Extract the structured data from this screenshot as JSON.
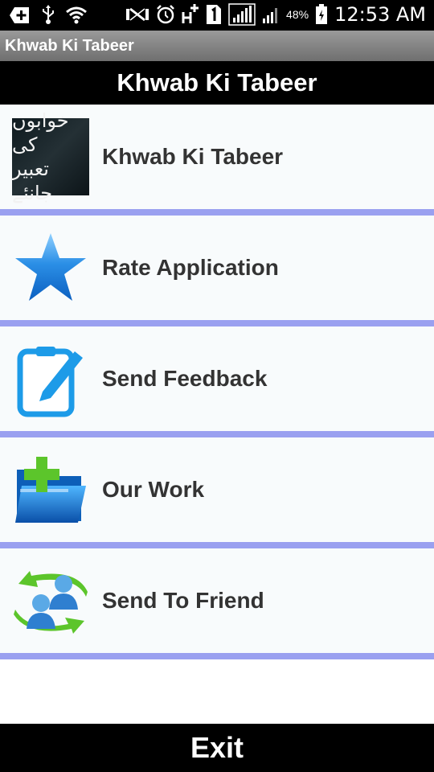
{
  "status_bar": {
    "battery": "48%",
    "time": "12:53 AM",
    "icons": [
      "add-icon",
      "usb-icon",
      "wifi-icon",
      "nfc-icon",
      "alarm-icon",
      "hplus-icon",
      "sim-1-icon",
      "signal-icon",
      "signal-2-icon",
      "battery-icon"
    ]
  },
  "app_title": "Khwab Ki Tabeer",
  "header": {
    "title": "Khwab Ki Tabeer"
  },
  "menu": {
    "items": [
      {
        "label": "Khwab Ki Tabeer",
        "icon": "app-thumbnail"
      },
      {
        "label": "Rate Application",
        "icon": "star-icon"
      },
      {
        "label": "Send Feedback",
        "icon": "edit-note-icon"
      },
      {
        "label": "Our Work",
        "icon": "folder-add-icon"
      },
      {
        "label": "Send To Friend",
        "icon": "share-users-icon"
      }
    ]
  },
  "exit": {
    "label": "Exit"
  },
  "colors": {
    "separator": "#9aa0f0",
    "header_bg": "#000000",
    "accent_blue": "#1e88e5"
  }
}
